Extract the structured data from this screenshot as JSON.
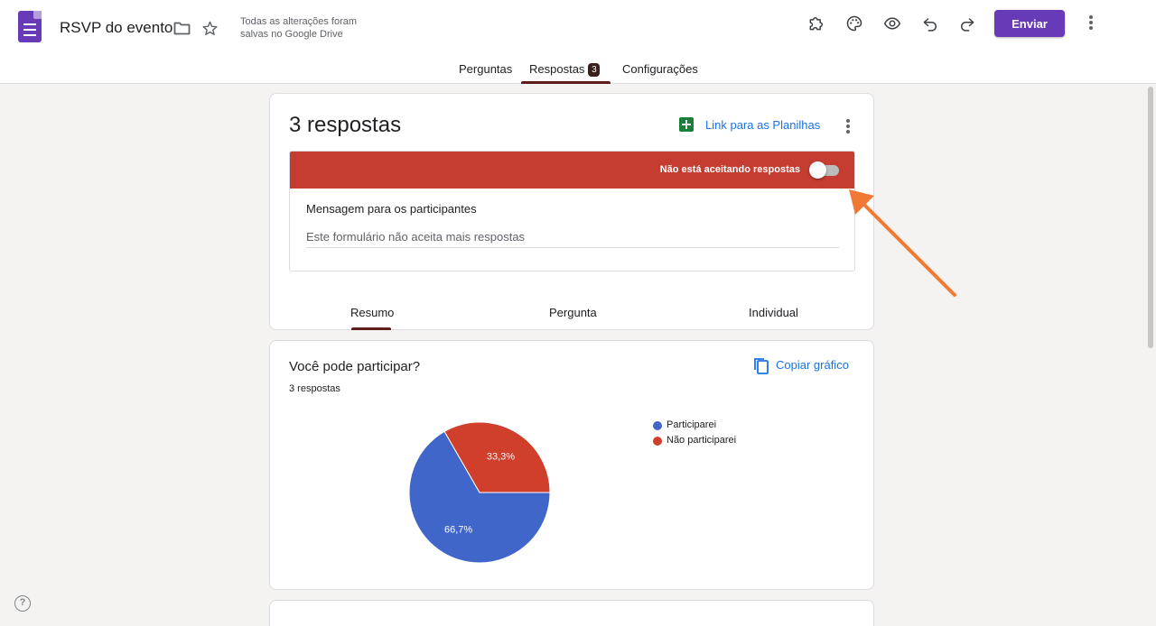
{
  "header": {
    "title": "RSVP do evento",
    "save_status": "Todas as alterações foram salvas no Google Drive",
    "send_label": "Enviar",
    "icons": [
      "folder-icon",
      "star-icon",
      "addon-icon",
      "palette-icon",
      "preview-icon",
      "undo-icon",
      "redo-icon",
      "more-vert-icon"
    ]
  },
  "tabs": {
    "questions": "Perguntas",
    "responses": "Respostas",
    "responses_badge": "3",
    "settings": "Configurações",
    "active": "Respostas"
  },
  "responses_card": {
    "count_label": "3 respostas",
    "sheets_link": "Link para as Planilhas",
    "accepting_label": "Não está aceitando respostas",
    "accepting": false,
    "message_label": "Mensagem para os participantes",
    "message_value": "Este formulário não aceita mais respostas",
    "subtabs": [
      "Resumo",
      "Pergunta",
      "Individual"
    ],
    "active_subtab": "Resumo"
  },
  "question_card": {
    "title": "Você pode participar?",
    "count": "3 respostas",
    "copy_label": "Copiar gráfico"
  },
  "chart_data": {
    "type": "pie",
    "categories": [
      "Participarei",
      "Não participarei"
    ],
    "values": [
      66.7,
      33.3
    ],
    "labels": [
      "66,7%",
      "33,3%"
    ],
    "colors": [
      "#3f66c8",
      "#cf3f2c"
    ],
    "legend_placement": "right"
  },
  "annotation": {
    "arrow_color": "#f07a35"
  }
}
